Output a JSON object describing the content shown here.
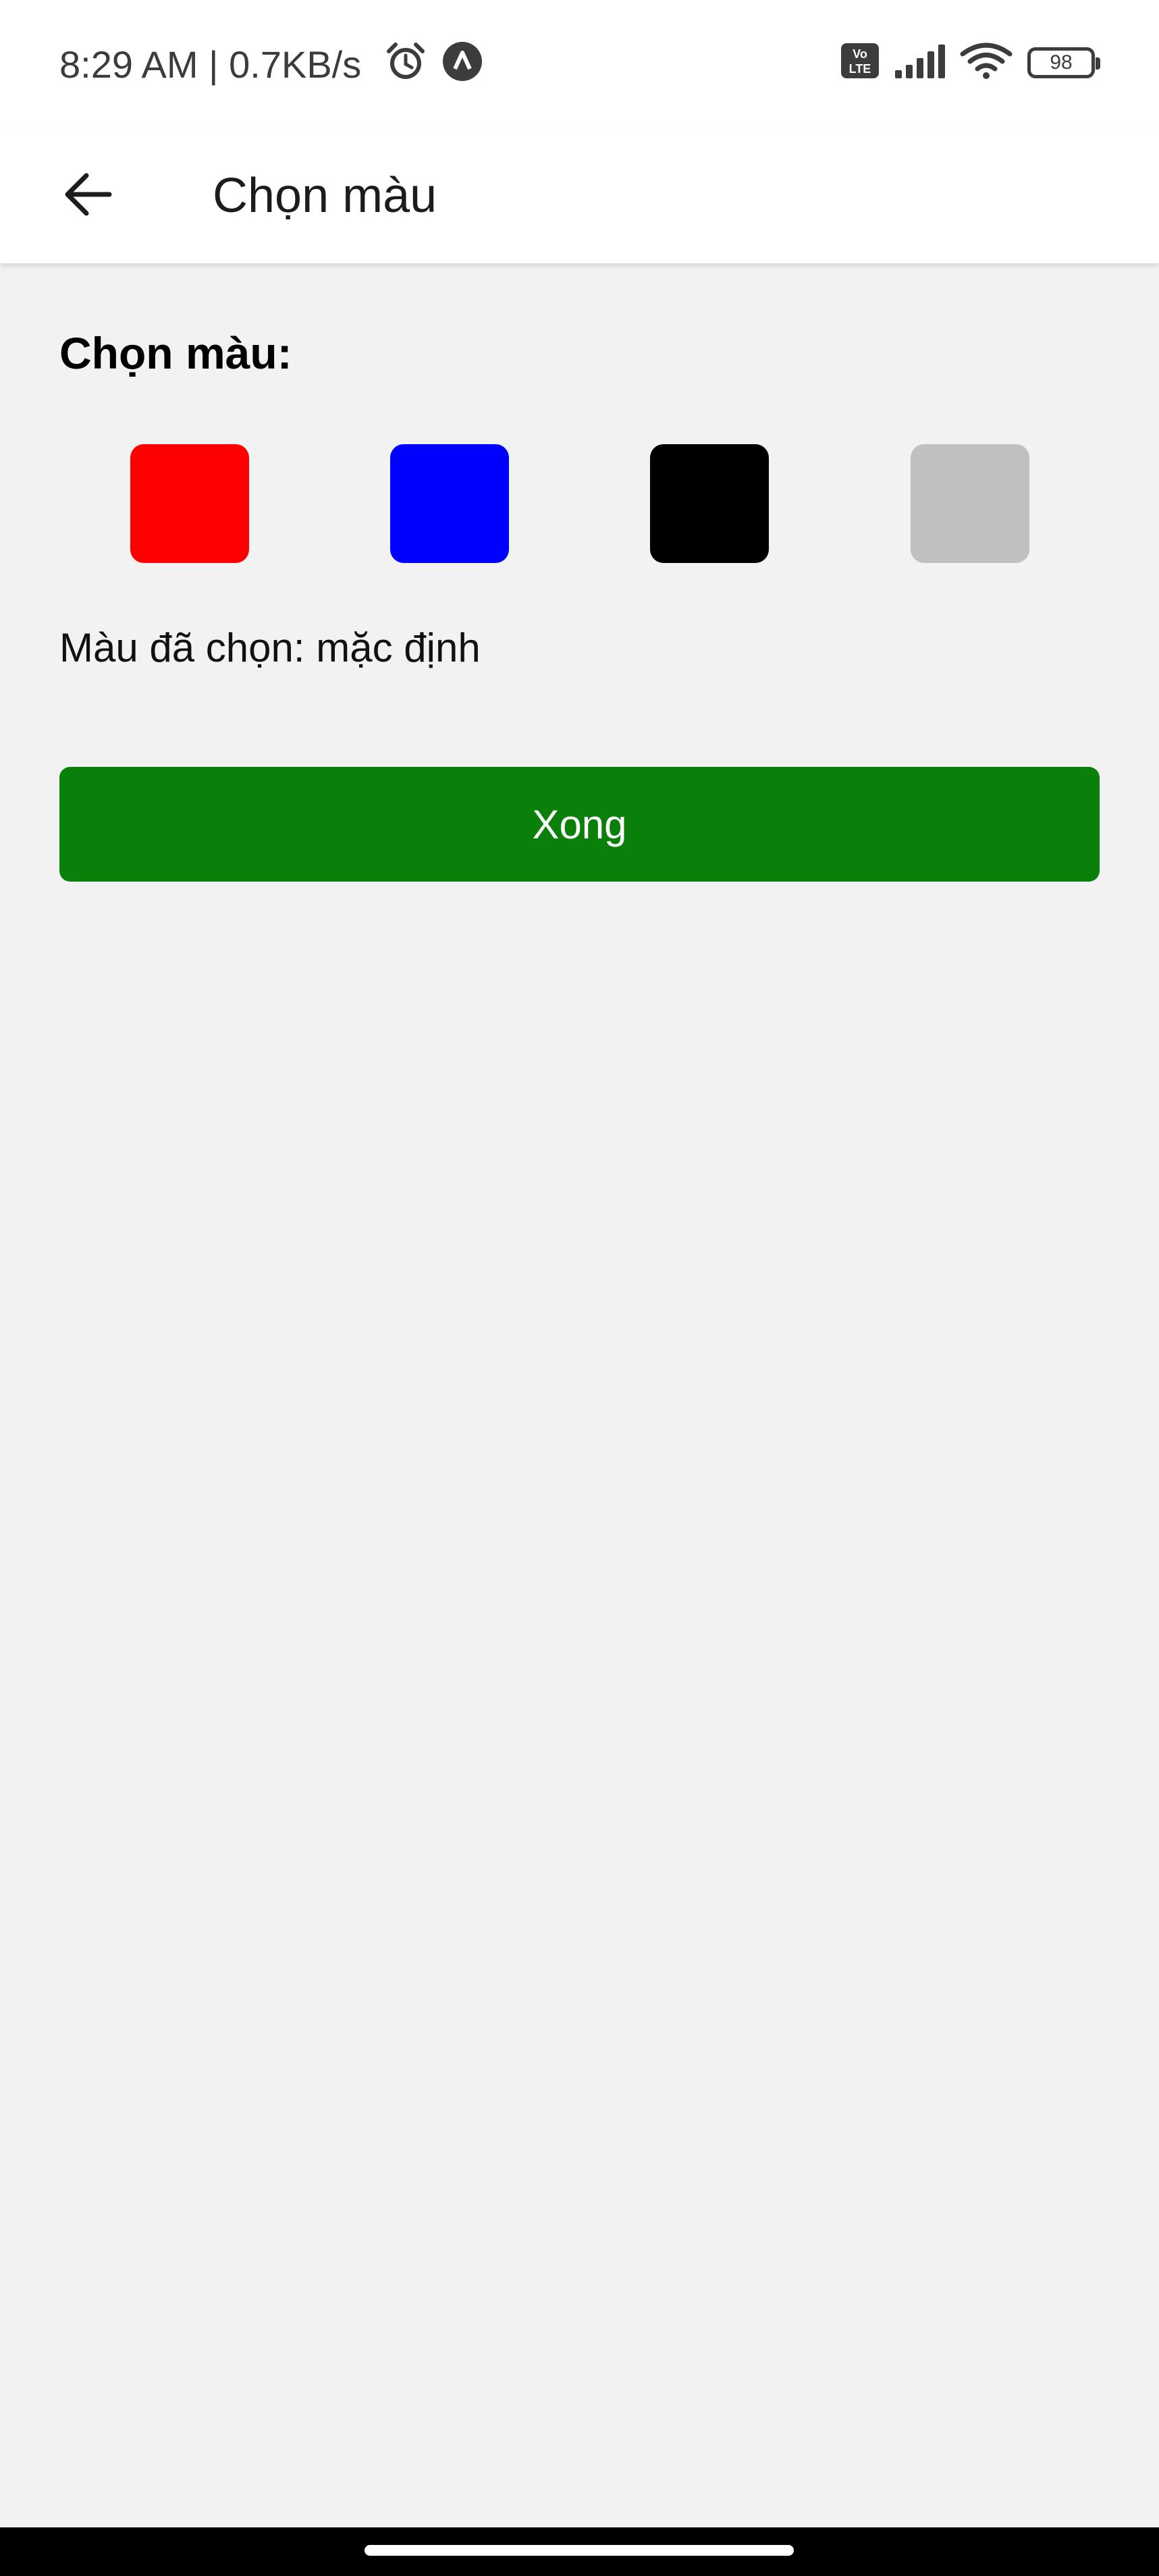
{
  "status_bar": {
    "time_text": "8:29 AM | 0.7KB/s",
    "battery_level": "98",
    "icons": [
      "alarm-icon",
      "app-notification-icon",
      "volte-icon",
      "cellular-signal-icon",
      "wifi-icon",
      "battery-icon"
    ]
  },
  "app_bar": {
    "title": "Chọn màu",
    "back_icon": "arrow-left-icon"
  },
  "content": {
    "section_label": "Chọn màu:",
    "swatches": [
      {
        "name": "red",
        "color": "#ff0000"
      },
      {
        "name": "blue",
        "color": "#0000ff"
      },
      {
        "name": "black",
        "color": "#000000"
      },
      {
        "name": "gray",
        "color": "#c0c0c0"
      }
    ],
    "selected_text": "Màu đã chọn: mặc định",
    "done_button_label": "Xong",
    "done_button_color": "#0a7f0a"
  },
  "colors": {
    "background": "#f2f2f2",
    "app_bar": "#ffffff",
    "status_icons": "#3c3c3c"
  }
}
